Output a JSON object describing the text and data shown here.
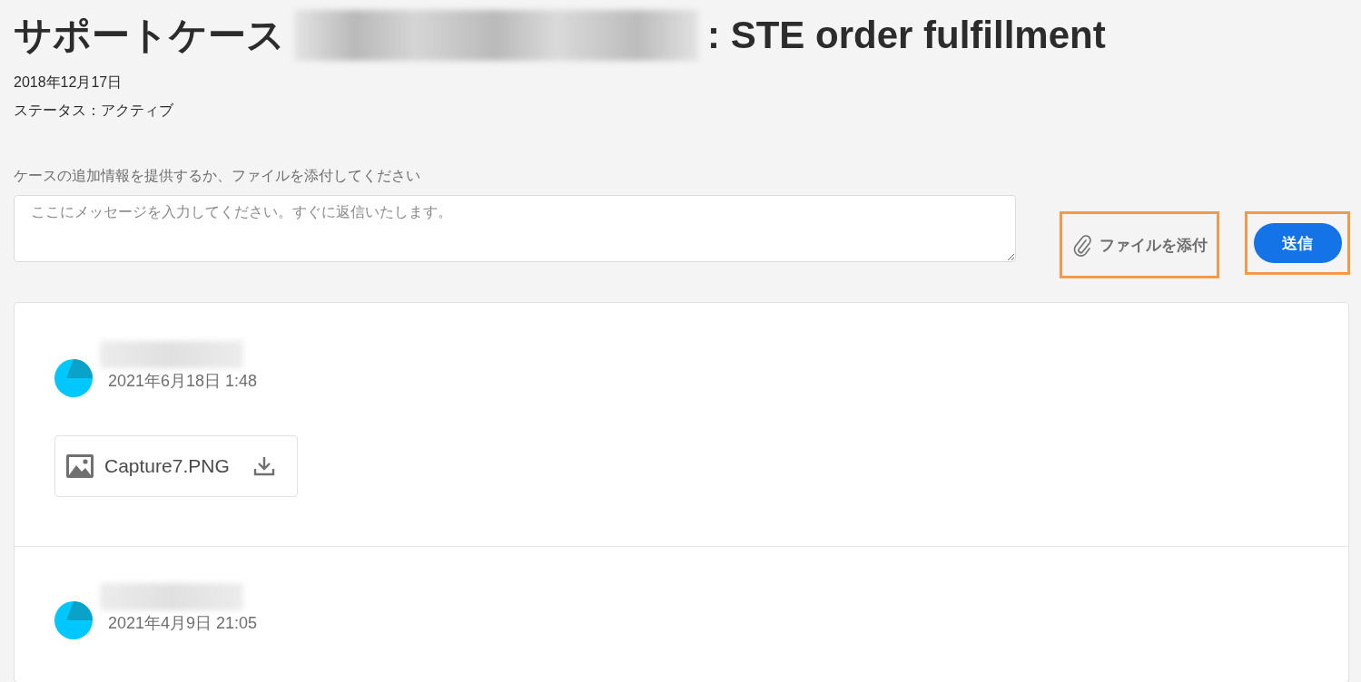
{
  "header": {
    "title_prefix": "サポートケース",
    "title_suffix": ": STE order fulfillment",
    "date": "2018年12月17日",
    "status": "ステータス：アクティブ"
  },
  "reply": {
    "label": "ケースの追加情報を提供するか、ファイルを添付してください",
    "placeholder": "ここにメッセージを入力してください。すぐに返信いたします。"
  },
  "actions": [
    {
      "kind": "attach",
      "label": "ファイルを添付",
      "highlighted": true
    },
    {
      "kind": "send",
      "label": "送信",
      "highlighted": true
    }
  ],
  "messages": [
    {
      "date": "2021年6月18日 1:48",
      "attachments": [
        {
          "name": "Capture7.PNG"
        }
      ]
    },
    {
      "date": "2021年4月9日 21:05"
    }
  ]
}
